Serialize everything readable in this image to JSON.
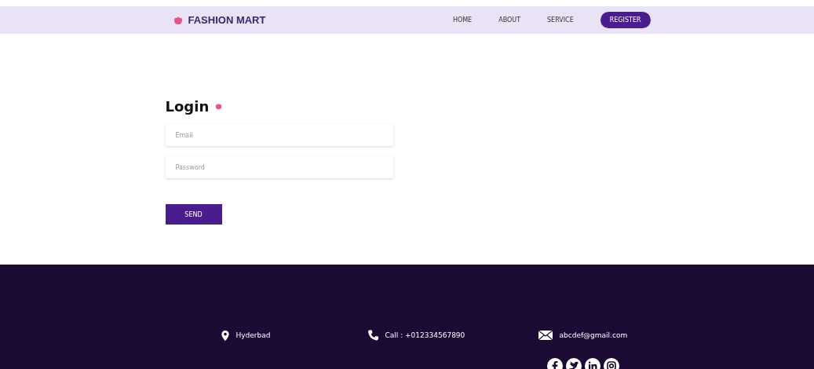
{
  "brand": "FASHION MART",
  "nav": [
    {
      "label": "HOME",
      "kind": "link"
    },
    {
      "label": "ABOUT",
      "kind": "link"
    },
    {
      "label": "SERVICE",
      "kind": "link"
    },
    {
      "label": "REGISTER",
      "kind": "button"
    }
  ],
  "login": {
    "title": "Login",
    "fields": [
      {
        "placeholder": "Email"
      },
      {
        "placeholder": "Password"
      }
    ],
    "submit": "SEND"
  },
  "footer": {
    "contacts": [
      {
        "kind": "location",
        "text": "Hyderbad"
      },
      {
        "kind": "phone",
        "text": "Call : +012334567890"
      },
      {
        "kind": "mail",
        "text": "abcdef@gmail.com"
      }
    ],
    "social": [
      {
        "kind": "facebook"
      },
      {
        "kind": "twitter"
      },
      {
        "kind": "linkedin"
      },
      {
        "kind": "instagram"
      }
    ]
  }
}
